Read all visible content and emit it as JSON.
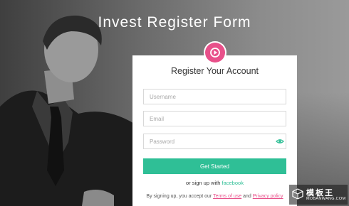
{
  "page": {
    "title": "Invest Register Form"
  },
  "form": {
    "heading": "Register Your Account",
    "username_placeholder": "Username",
    "email_placeholder": "Email",
    "password_placeholder": "Password",
    "submit_label": "Get Started",
    "alt_prefix": "or sign up with",
    "alt_link": "facebook",
    "terms_prefix": "By signing up, you accept our",
    "terms_link": "Terms of use",
    "terms_and": "and",
    "privacy_link": "Privacy policy"
  },
  "watermark": {
    "cn": "模板王",
    "en": "MOBANWANG.COM"
  },
  "colors": {
    "accent": "#2fbf96",
    "logo": "#e8508a"
  },
  "icons": {
    "logo": "play-icon",
    "password_toggle": "eye-icon",
    "watermark": "cube-logo-icon"
  }
}
